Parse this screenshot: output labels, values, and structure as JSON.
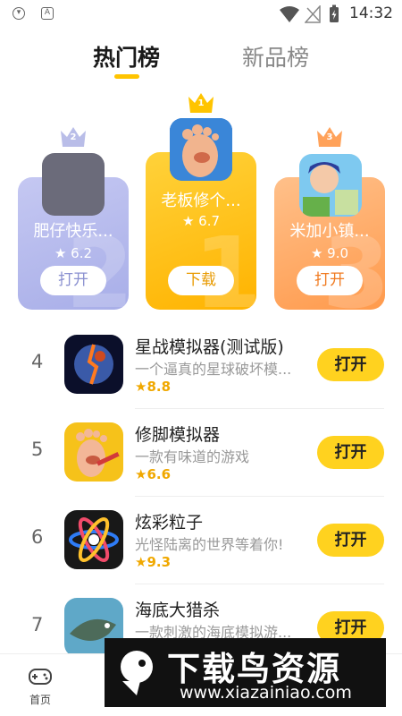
{
  "status_bar": {
    "time": "14:32"
  },
  "tabs": [
    {
      "label": "热门榜",
      "active": true
    },
    {
      "label": "新品榜",
      "active": false
    }
  ],
  "podium": [
    {
      "rank": "2",
      "name": "肥仔快乐...",
      "rating": "6.2",
      "button": "打开",
      "icon": "placeholder-icon"
    },
    {
      "rank": "1",
      "name": "老板修个...",
      "rating": "6.7",
      "button": "下载",
      "icon": "foot-icon"
    },
    {
      "rank": "3",
      "name": "米加小镇...",
      "rating": "9.0",
      "button": "打开",
      "icon": "town-icon"
    }
  ],
  "list": [
    {
      "rank": "4",
      "title": "星战模拟器(测试版)",
      "desc": "一个逼真的星球破坏模...",
      "rating": "8.8",
      "button": "打开",
      "icon": "planet-icon"
    },
    {
      "rank": "5",
      "title": "修脚模拟器",
      "desc": "一款有味道的游戏",
      "rating": "6.6",
      "button": "打开",
      "icon": "foot-icon"
    },
    {
      "rank": "6",
      "title": "炫彩粒子",
      "desc": "光怪陆离的世界等着你!",
      "rating": "9.3",
      "button": "打开",
      "icon": "particle-icon"
    },
    {
      "rank": "7",
      "title": "海底大猎杀",
      "desc": "一款刺激的海底模拟游...",
      "rating": "",
      "button": "打开",
      "icon": "fish-icon"
    }
  ],
  "bottom_nav": {
    "home_label": "首页"
  },
  "watermark": {
    "title": "下载鸟资源",
    "url": "www.xiazainiao.com"
  },
  "colors": {
    "accent": "#ffd21f",
    "tab_underline": "#ffc400",
    "rating": "#f0a800"
  }
}
